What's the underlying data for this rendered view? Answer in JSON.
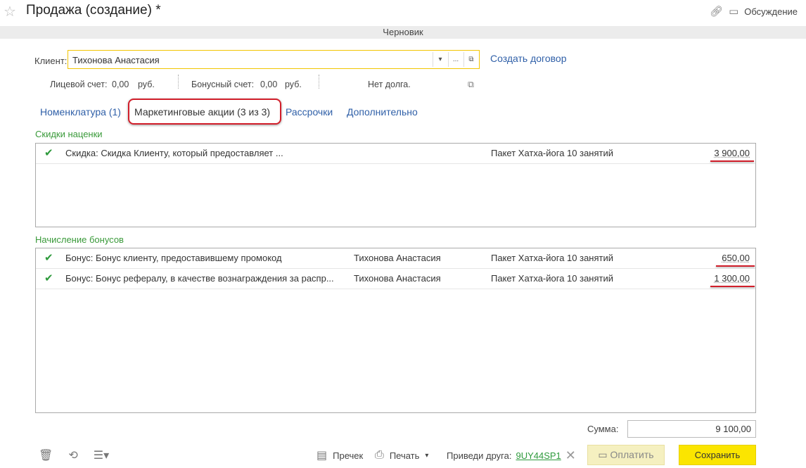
{
  "window": {
    "title": "Продажа (создание) *",
    "discussion_label": "Обсуждение",
    "status": "Черновик"
  },
  "client": {
    "label": "Клиент:",
    "value": "Тихонова Анастасия",
    "dropdown_icon": "▾",
    "select_icon": "...",
    "open_icon": "⧉",
    "create_contract": "Создать договор"
  },
  "accounts": {
    "personal_label": "Лицевой счет:",
    "personal_value": "0,00",
    "personal_currency": "руб.",
    "bonus_label": "Бонусный счет:",
    "bonus_value": "0,00",
    "bonus_currency": "руб.",
    "debt_text": "Нет долга."
  },
  "tabs": [
    {
      "label": "Номенклатура (1)"
    },
    {
      "label": "Маркетинговые акции (3 из 3)"
    },
    {
      "label": "Рассрочки"
    },
    {
      "label": "Дополнительно"
    }
  ],
  "discounts": {
    "title": "Скидки наценки",
    "rows": [
      {
        "description": "Скидка: Скидка Клиенту, который предоставляет ...",
        "client": "",
        "product": "Пакет Хатха-йога 10 занятий",
        "amount": "3 900,00"
      }
    ]
  },
  "bonuses": {
    "title": "Начисление бонусов",
    "rows": [
      {
        "description": "Бонус: Бонус клиенту, предоставившему промокод",
        "client": "Тихонова Анастасия",
        "product": "Пакет Хатха-йога 10 занятий",
        "amount": "650,00"
      },
      {
        "description": "Бонус: Бонус рефералу, в качестве вознаграждения за распр...",
        "client": "Тихонова Анастасия",
        "product": "Пакет Хатха-йога 10 занятий",
        "amount": "1 300,00"
      }
    ]
  },
  "total": {
    "label": "Сумма:",
    "value": "9 100,00"
  },
  "footer": {
    "receipt_label": "Пречек",
    "print_label": "Печать",
    "refer_label": "Приведи друга:",
    "promo_code": "9UY44SP1",
    "pay_label": "Оплатить",
    "save_label": "Сохранить"
  },
  "icons": {
    "star": "star-icon",
    "link": "link-icon",
    "discussion": "discussion-icon",
    "check": "check-icon",
    "trash": "trash-icon",
    "history": "history-icon",
    "menu": "menu-icon",
    "receipt": "receipt-icon",
    "printer": "printer-icon",
    "close": "close-icon",
    "card": "card-icon"
  },
  "colors": {
    "accent_yellow": "#fbe500",
    "link_blue": "#3060a8",
    "section_green": "#3a9a3a",
    "highlight_red": "#d21f2b"
  }
}
